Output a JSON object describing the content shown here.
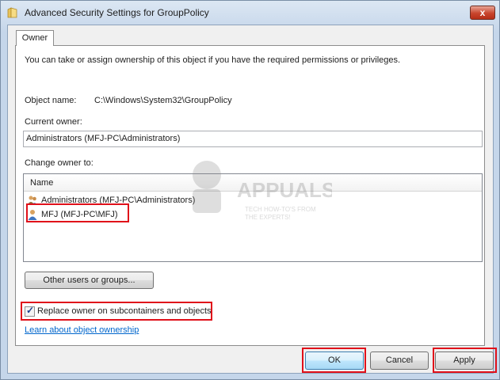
{
  "window": {
    "title": "Advanced Security Settings for GroupPolicy",
    "close_label": "x"
  },
  "tabs": [
    {
      "label": "Owner"
    }
  ],
  "owner": {
    "intro": "You can take or assign ownership of this object if you have the required permissions or privileges.",
    "object_name_label": "Object name:",
    "object_name_value": "C:\\Windows\\System32\\GroupPolicy",
    "current_owner_label": "Current owner:",
    "current_owner_value": "Administrators (MFJ-PC\\Administrators)",
    "change_owner_label": "Change owner to:",
    "list_header": "Name",
    "list_items": [
      {
        "label": "Administrators (MFJ-PC\\Administrators)",
        "icon": "group-users-icon"
      },
      {
        "label": "MFJ (MFJ-PC\\MFJ)",
        "icon": "user-icon",
        "selected": true
      }
    ],
    "other_users_button": "Other users or groups...",
    "replace_owner_label": "Replace owner on subcontainers and objects",
    "replace_owner_checked": true,
    "learn_link": "Learn about object ownership"
  },
  "watermark": {
    "brand": "APPUALS",
    "tagline_1": "TECH HOW-TO'S FROM",
    "tagline_2": "THE EXPERTS!"
  },
  "footer": {
    "ok_label": "OK",
    "cancel_label": "Cancel",
    "apply_label": "Apply"
  },
  "colors": {
    "highlight_box": "#e0101a",
    "link": "#0066cc"
  }
}
